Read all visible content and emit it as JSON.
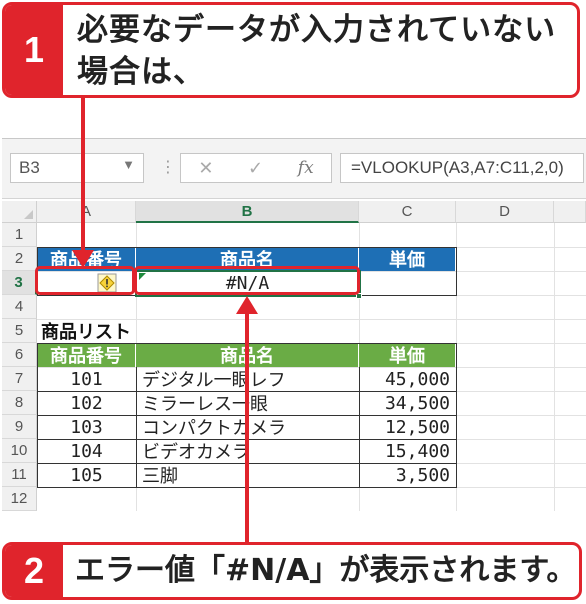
{
  "callout1": {
    "number": "1",
    "line1": "必要なデータが入力されていない",
    "line2": "場合は、"
  },
  "callout2": {
    "number": "2",
    "text": "エラー値「#N/A」が表示されます。"
  },
  "formula_bar": {
    "name_box": "B3",
    "name_box_dropdown": "▼",
    "dots": "⋮",
    "cancel_icon": "✕",
    "enter_icon": "✓",
    "fx_label": "fx",
    "formula": "=VLOOKUP(A3,A7:C11,2,0)"
  },
  "columns": [
    "A",
    "B",
    "C",
    "D"
  ],
  "rows": [
    "1",
    "2",
    "3",
    "4",
    "5",
    "6",
    "7",
    "8",
    "9",
    "10",
    "11",
    "12"
  ],
  "input_table": {
    "headers": [
      "商品番号",
      "商品名",
      "単価"
    ],
    "row3": {
      "a": "",
      "b": "#N/A",
      "c": ""
    }
  },
  "list_title": "商品リスト",
  "product_list": {
    "headers": [
      "商品番号",
      "商品名",
      "単価"
    ],
    "rows": [
      {
        "code": "101",
        "name": "デジタル一眼レフ",
        "price": "45,000"
      },
      {
        "code": "102",
        "name": "ミラーレス一眼",
        "price": "34,500"
      },
      {
        "code": "103",
        "name": "コンパクトカメラ",
        "price": "12,500"
      },
      {
        "code": "104",
        "name": "ビデオカメラ",
        "price": "15,400"
      },
      {
        "code": "105",
        "name": "三脚",
        "price": "3,500"
      }
    ]
  },
  "icons": {
    "error_warning": "warning-diamond-icon",
    "arrow": "red-arrow-icon"
  },
  "colors": {
    "accent_red": "#e0242c",
    "header_blue": "#1e6fb5",
    "header_green": "#6aac45",
    "excel_green": "#217346"
  }
}
